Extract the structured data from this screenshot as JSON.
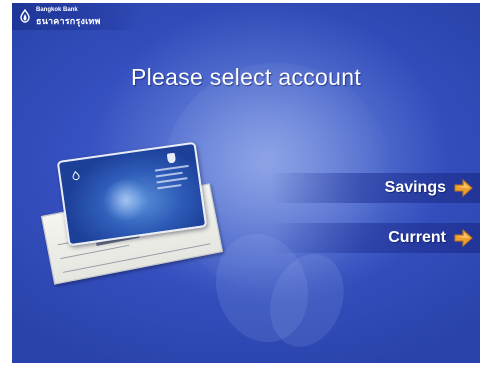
{
  "header": {
    "logo_icon": "lotus-icon",
    "bank_name_en": "Bangkok Bank",
    "bank_name_th": "ธนาคารกรุงเทพ"
  },
  "screen": {
    "title": "Please select account"
  },
  "options": [
    {
      "label": "Savings",
      "icon": "arrow-right-icon"
    },
    {
      "label": "Current",
      "icon": "arrow-right-icon"
    }
  ],
  "illustration": {
    "items": [
      "atm-card",
      "cheque"
    ]
  },
  "colors": {
    "background": "#3550bf",
    "header": "#1e3597",
    "text": "#ffffff",
    "arrow": "#f0a030"
  }
}
